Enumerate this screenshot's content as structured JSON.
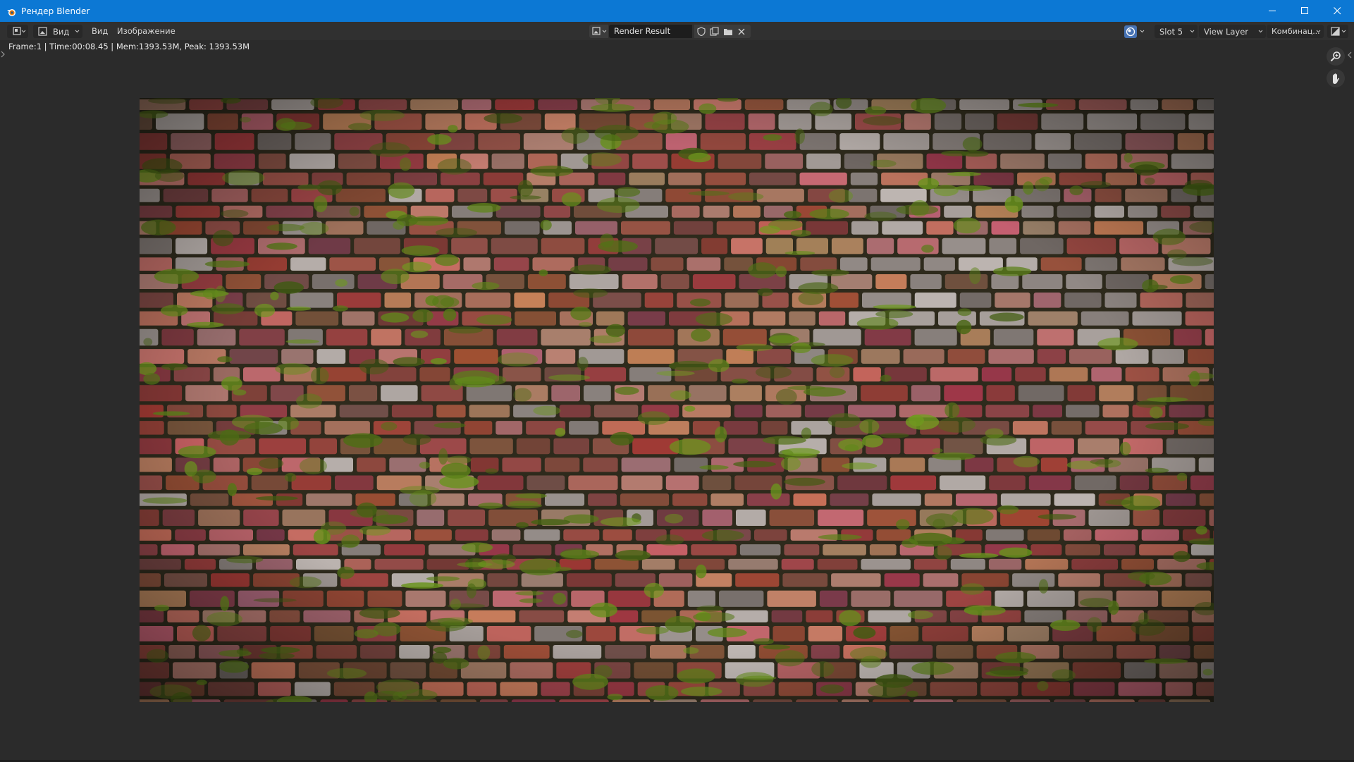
{
  "window": {
    "title": "Рендер Blender",
    "controls": [
      "minimize-icon",
      "maximize-icon",
      "close-icon"
    ],
    "titlebar_color": "#0c78d4"
  },
  "header": {
    "editor_type_icon": "image-editor-icon",
    "view_mode": "Вид",
    "menus": [
      "Вид",
      "Изображение"
    ],
    "image_name": "Render Result",
    "slot": "Slot 5",
    "view_layer": "View Layer",
    "pass": "Комбинац...",
    "icons": [
      "image-browse-icon",
      "fake-user-shield-icon",
      "new-image-icon",
      "open-folder-icon",
      "unlink-x-icon",
      "gizmo-toggle-icon",
      "display-channels-icon"
    ]
  },
  "status": {
    "text": "Frame:1 | Time:00:08.45 | Mem:1393.53M, Peak: 1393.53M"
  },
  "viewport": {
    "tools": [
      "zoom-icon",
      "pan-hand-icon"
    ],
    "image_content": "mossy brick wall render"
  },
  "colors": {
    "header_bg": "#303030",
    "viewport_bg": "#2b2b2b",
    "field_bg": "#1d1d1d"
  }
}
